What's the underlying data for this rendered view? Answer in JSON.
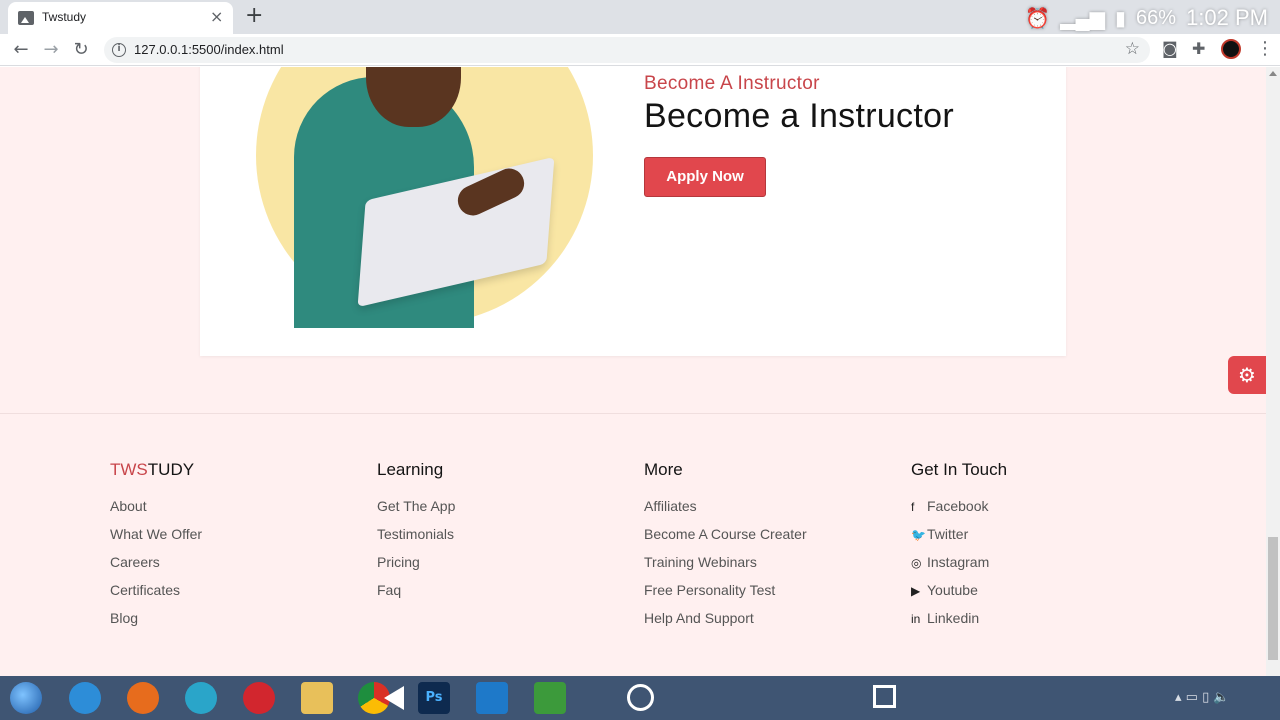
{
  "browser": {
    "tab_title": "Twstudy",
    "tab_close": "×",
    "new_tab": "+",
    "url": "127.0.0.1:5500/index.html",
    "status_battery": "66%",
    "status_time": "1:02 PM"
  },
  "instructor": {
    "kicker": "Become A Instructor",
    "heading": "Become a Instructor",
    "apply_button": "Apply Now"
  },
  "footer": {
    "brand": {
      "accent": "TWS",
      "rest": "TUDY"
    },
    "columns": [
      {
        "title": "TWSTUDY",
        "links": [
          "About",
          "What We Offer",
          "Careers",
          "Certificates",
          "Blog"
        ]
      },
      {
        "title": "Learning",
        "links": [
          "Get The App",
          "Testimonials",
          "Pricing",
          "Faq"
        ]
      },
      {
        "title": "More",
        "links": [
          "Affiliates",
          "Become A Course Creater",
          "Training Webinars",
          "Free Personality Test",
          "Help And Support"
        ]
      },
      {
        "title": "Get In Touch",
        "links": [
          "Facebook",
          "Twitter",
          "Instagram",
          "Youtube",
          "Linkedin"
        ]
      }
    ],
    "social_icons": [
      "facebook-icon",
      "twitter-icon",
      "instagram-icon",
      "youtube-icon",
      "linkedin-icon"
    ]
  },
  "taskbar": {
    "ps_label": "Ps"
  },
  "colors": {
    "accent": "#e1474d",
    "page_bg": "#fff0f0"
  }
}
